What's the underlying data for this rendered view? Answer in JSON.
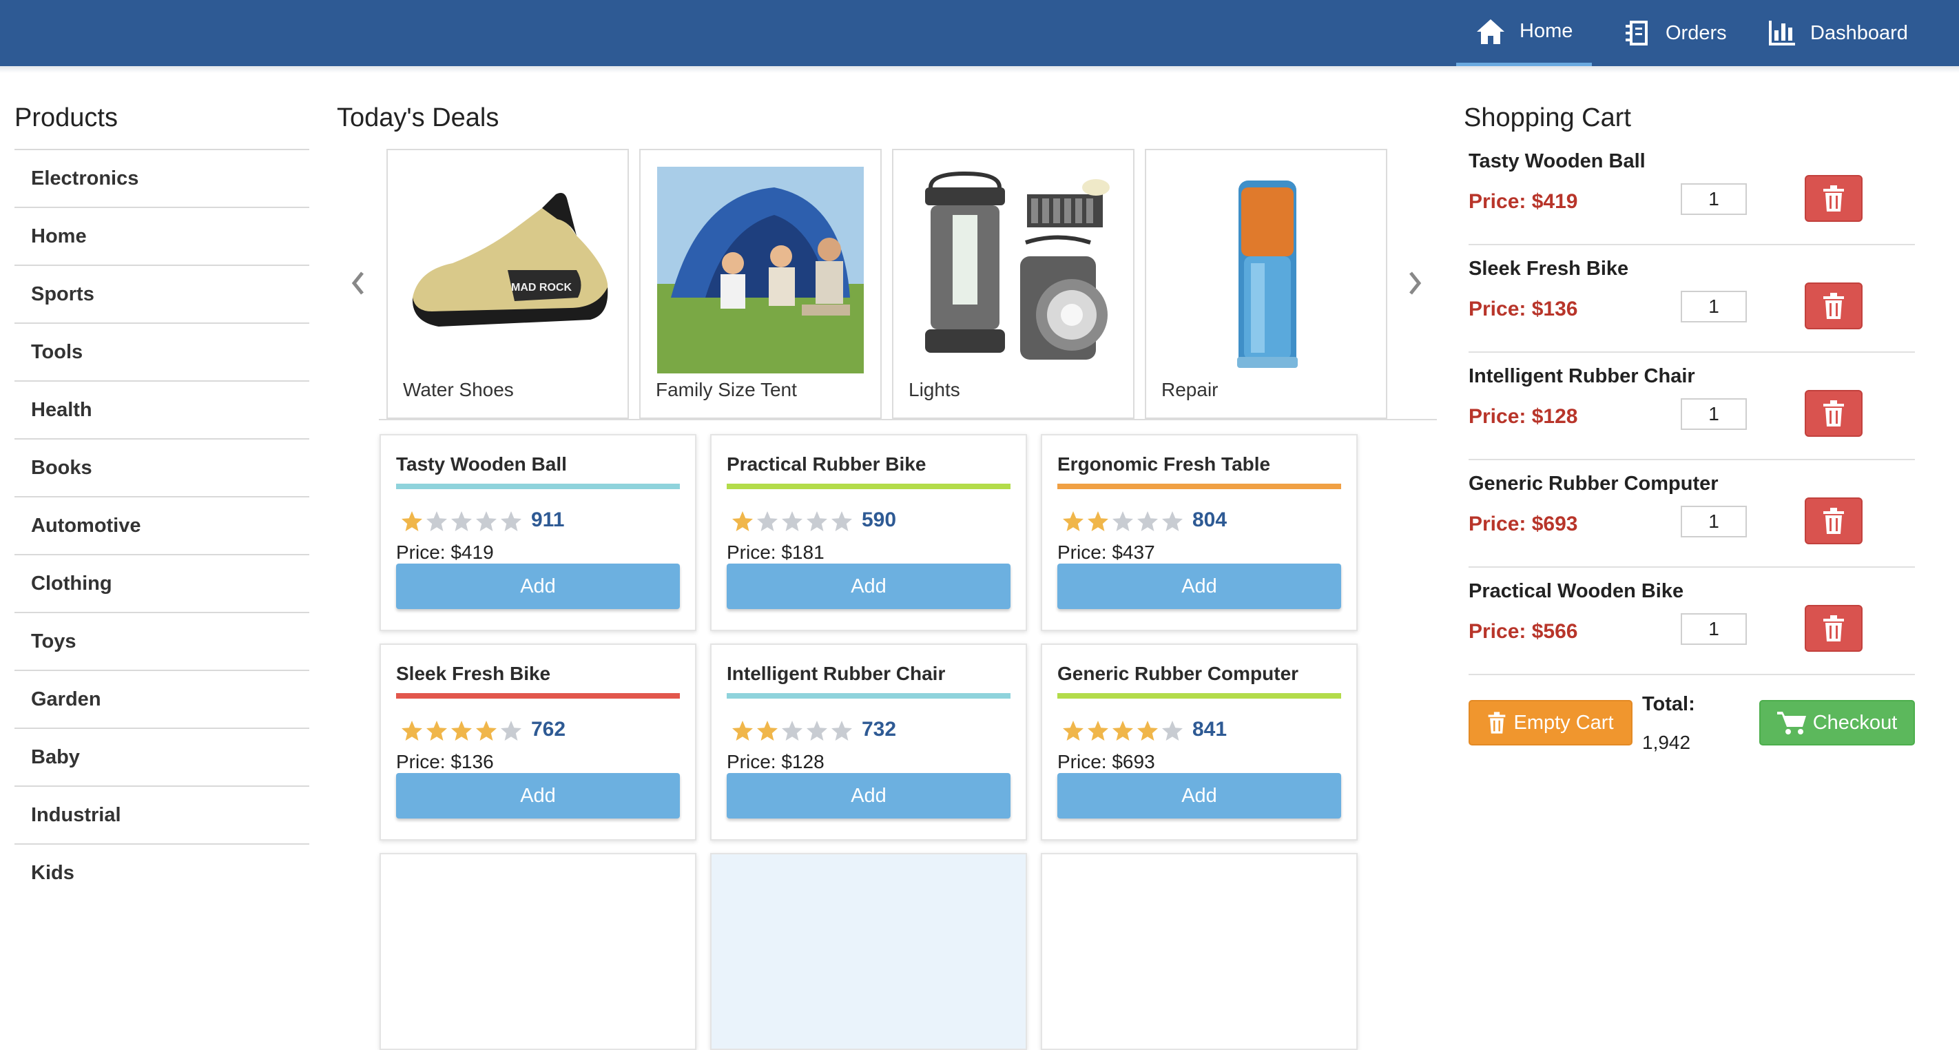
{
  "nav": {
    "items": [
      {
        "label": "Home",
        "icon": "home-icon",
        "active": true
      },
      {
        "label": "Orders",
        "icon": "orders-icon",
        "active": false
      },
      {
        "label": "Dashboard",
        "icon": "dashboard-icon",
        "active": false
      }
    ]
  },
  "sidebar": {
    "title": "Products",
    "items": [
      {
        "label": "Electronics"
      },
      {
        "label": "Home"
      },
      {
        "label": "Sports"
      },
      {
        "label": "Tools"
      },
      {
        "label": "Health"
      },
      {
        "label": "Books"
      },
      {
        "label": "Automotive"
      },
      {
        "label": "Clothing"
      },
      {
        "label": "Toys"
      },
      {
        "label": "Garden"
      },
      {
        "label": "Baby"
      },
      {
        "label": "Industrial"
      },
      {
        "label": "Kids"
      }
    ]
  },
  "deals": {
    "title": "Today's Deals",
    "items": [
      {
        "label": "Water Shoes",
        "image": "shoe"
      },
      {
        "label": "Family Size Tent",
        "image": "tent"
      },
      {
        "label": "Lights",
        "image": "lantern"
      },
      {
        "label": "Repair",
        "image": "tape"
      }
    ]
  },
  "products": [
    {
      "name": "Tasty Wooden Ball",
      "rating": 1,
      "reviews": "911",
      "price": "Price: $419",
      "bar_color": "#8fd3dc",
      "add_label": "Add"
    },
    {
      "name": "Practical Rubber Bike",
      "rating": 1,
      "reviews": "590",
      "price": "Price: $181",
      "bar_color": "#b3dc4a",
      "add_label": "Add"
    },
    {
      "name": "Ergonomic Fresh Table",
      "rating": 2,
      "reviews": "804",
      "price": "Price: $437",
      "bar_color": "#f0a044",
      "add_label": "Add"
    },
    {
      "name": "Sleek Fresh Bike",
      "rating": 4,
      "reviews": "762",
      "price": "Price: $136",
      "bar_color": "#e2574c",
      "add_label": "Add"
    },
    {
      "name": "Intelligent Rubber Chair",
      "rating": 2,
      "reviews": "732",
      "price": "Price: $128",
      "bar_color": "#8fd3dc",
      "add_label": "Add"
    },
    {
      "name": "Generic Rubber Computer",
      "rating": 4,
      "reviews": "841",
      "price": "Price: $693",
      "bar_color": "#b3dc4a",
      "add_label": "Add"
    }
  ],
  "cart": {
    "title": "Shopping Cart",
    "items": [
      {
        "name": "Tasty Wooden Ball",
        "price": "Price: $419",
        "qty": "1"
      },
      {
        "name": "Sleek Fresh Bike",
        "price": "Price: $136",
        "qty": "1"
      },
      {
        "name": "Intelligent Rubber Chair",
        "price": "Price: $128",
        "qty": "1"
      },
      {
        "name": "Generic Rubber Computer",
        "price": "Price: $693",
        "qty": "1"
      },
      {
        "name": "Practical Wooden Bike",
        "price": "Price: $566",
        "qty": "1"
      }
    ],
    "empty_label": "Empty Cart",
    "total_label": "Total:",
    "total_value": "1,942",
    "checkout_label": "Checkout"
  },
  "colors": {
    "nav_bg": "#2e5a94",
    "star_on": "#f0b64a",
    "star_off": "#c8ccd2",
    "add_button": "#6cb0e0",
    "delete_button": "#d9534f",
    "empty_button": "#f0962e",
    "checkout_button": "#5cb85c",
    "cart_price": "#b8352a"
  }
}
